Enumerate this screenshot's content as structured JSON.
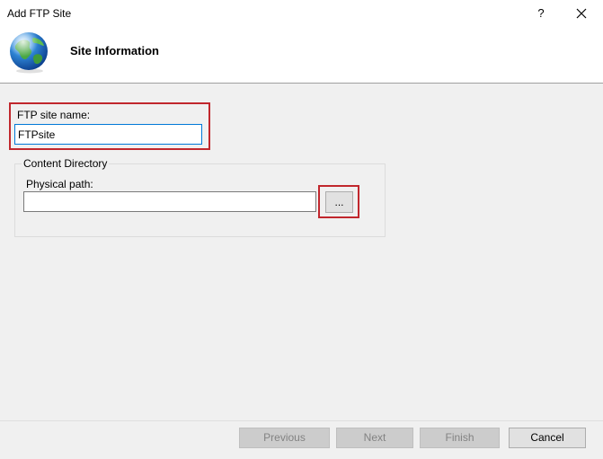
{
  "window": {
    "title": "Add FTP Site",
    "help_label": "?"
  },
  "header": {
    "title": "Site Information",
    "icon": "globe-icon"
  },
  "site_name": {
    "label": "FTP site name:",
    "value": "FTPsite"
  },
  "content_directory": {
    "legend": "Content Directory",
    "path_label": "Physical path:",
    "path_value": "",
    "browse_label": "..."
  },
  "footer": {
    "previous_label": "Previous",
    "next_label": "Next",
    "finish_label": "Finish",
    "cancel_label": "Cancel"
  },
  "colors": {
    "highlight": "#c1272d",
    "focus_border": "#0078d7"
  }
}
